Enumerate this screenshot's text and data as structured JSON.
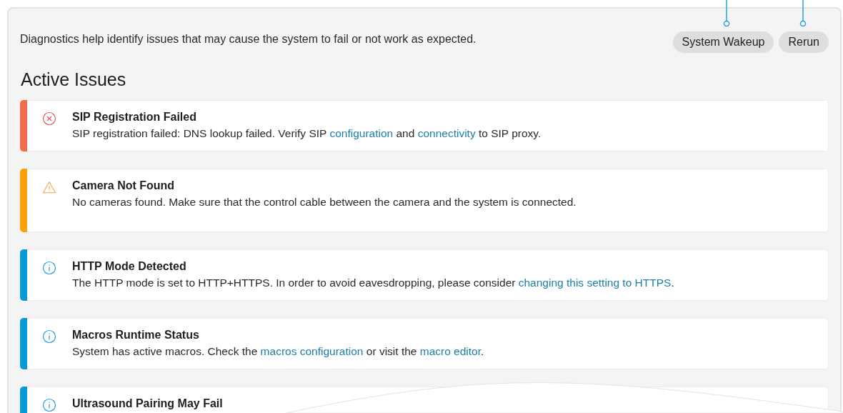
{
  "intro": "Diagnostics help identify issues that may cause the system to fail or not work as expected.",
  "buttons": [
    {
      "label": "System Wakeup"
    },
    {
      "label": "Rerun"
    }
  ],
  "section_title": "Active Issues",
  "issues": [
    {
      "kind": "error",
      "title": "SIP Registration Failed",
      "parts": [
        {
          "kind": "text",
          "text": "SIP registration failed: DNS lookup failed. Verify SIP "
        },
        {
          "kind": "link",
          "text": "configuration"
        },
        {
          "kind": "text",
          "text": " and "
        },
        {
          "kind": "link",
          "text": "connectivity"
        },
        {
          "kind": "text",
          "text": " to SIP proxy."
        }
      ]
    },
    {
      "kind": "warning",
      "title": "Camera Not Found",
      "parts": [
        {
          "kind": "text",
          "text": "No cameras found. Make sure that the control cable between the camera and the system is connected."
        }
      ]
    },
    {
      "kind": "info",
      "title": "HTTP Mode Detected",
      "parts": [
        {
          "kind": "text",
          "text": "The HTTP mode is set to HTTP+HTTPS. In order to avoid eavesdropping, please consider "
        },
        {
          "kind": "link",
          "text": "changing this setting to HTTPS"
        },
        {
          "kind": "text",
          "text": "."
        }
      ]
    },
    {
      "kind": "info",
      "title": "Macros Runtime Status",
      "parts": [
        {
          "kind": "text",
          "text": "System has active macros. Check the "
        },
        {
          "kind": "link",
          "text": "macros configuration"
        },
        {
          "kind": "text",
          "text": " or visit the "
        },
        {
          "kind": "link",
          "text": "macro editor"
        },
        {
          "kind": "text",
          "text": "."
        }
      ]
    },
    {
      "kind": "info",
      "title": "Ultrasound Pairing May Fail"
    }
  ]
}
